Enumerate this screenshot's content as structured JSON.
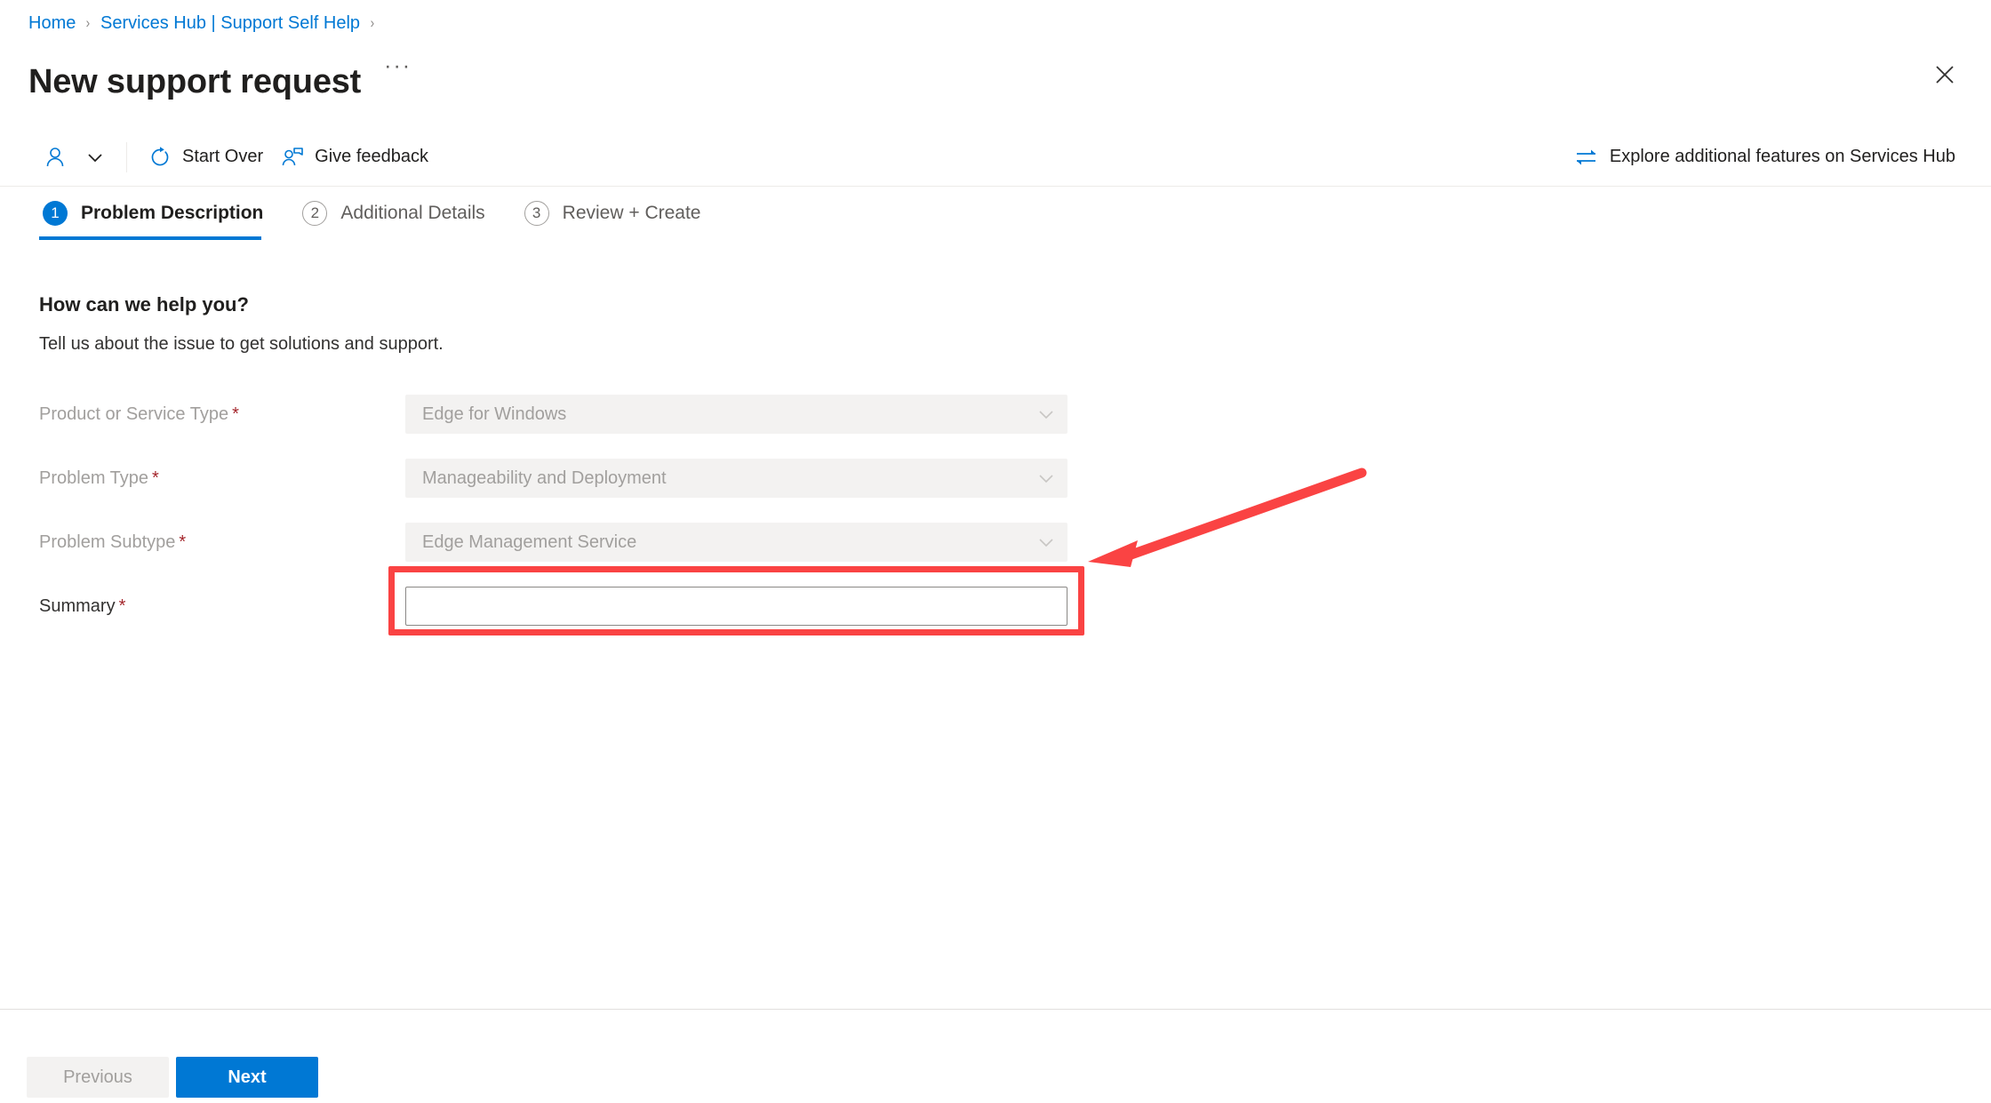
{
  "breadcrumb": {
    "items": [
      {
        "label": "Home"
      },
      {
        "label": "Services Hub | Support Self Help"
      }
    ],
    "separator": "›"
  },
  "header": {
    "title": "New support request",
    "ellipsis": "···",
    "close_icon": "close-icon"
  },
  "commandbar": {
    "account_icon": "person-icon",
    "account_chevron_icon": "chevron-down-icon",
    "start_over": {
      "label": "Start Over",
      "icon": "refresh-icon"
    },
    "give_feedback": {
      "label": "Give feedback",
      "icon": "feedback-person-icon"
    },
    "explore": {
      "label": "Explore additional features on Services Hub",
      "icon": "swap-arrows-icon"
    }
  },
  "steps": [
    {
      "num": "1",
      "label": "Problem Description",
      "state": "active"
    },
    {
      "num": "2",
      "label": "Additional Details",
      "state": "inactive"
    },
    {
      "num": "3",
      "label": "Review + Create",
      "state": "inactive"
    }
  ],
  "section": {
    "heading": "How can we help you?",
    "subtext": "Tell us about the issue to get solutions and support."
  },
  "form": {
    "required_mark": "*",
    "fields": [
      {
        "label": "Product or Service Type",
        "type": "dropdown",
        "value": "Edge for Windows",
        "disabled": true,
        "required": true
      },
      {
        "label": "Problem Type",
        "type": "dropdown",
        "value": "Manageability and Deployment",
        "disabled": true,
        "required": true
      },
      {
        "label": "Problem Subtype",
        "type": "dropdown",
        "value": "Edge Management Service",
        "disabled": true,
        "required": true
      },
      {
        "label": "Summary",
        "type": "text",
        "value": "",
        "placeholder": "",
        "disabled": false,
        "required": true
      }
    ]
  },
  "footer": {
    "previous_label": "Previous",
    "next_label": "Next"
  },
  "annotation": {
    "highlight_color": "#fa4343",
    "target": "summary-input"
  },
  "colors": {
    "accent": "#0078d4",
    "link": "#0078d4",
    "required": "#a4262c",
    "disabled_text": "#a19f9d",
    "disabled_bg": "#f3f2f1",
    "text": "#201f1e"
  }
}
